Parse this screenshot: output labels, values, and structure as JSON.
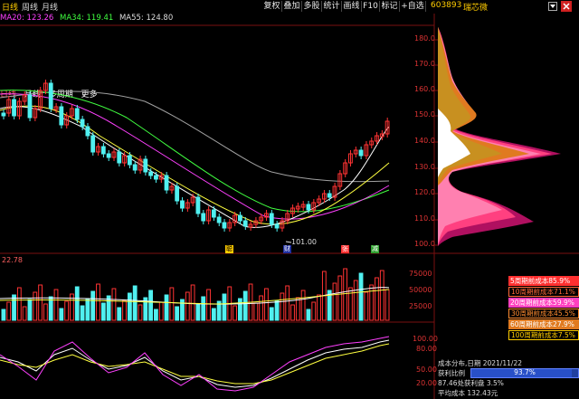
{
  "topbar": {
    "periods": [
      "日线",
      "周线",
      "月线"
    ],
    "tools": [
      "复权",
      "叠加",
      "多股",
      "统计",
      "画线",
      "F10",
      "标记",
      "+自选"
    ],
    "stock_code": "603893",
    "stock_name": "瑞芯微"
  },
  "ma_line": {
    "ma20": "MA20: 123.26",
    "ma34": "MA34: 119.41",
    "ma55": "MA55: 124.80"
  },
  "period_tabs": [
    "日线",
    "月线",
    "多周期",
    "更多"
  ],
  "price_axis": [
    "180.0",
    "170.0",
    "160.0",
    "150.0",
    "140.0",
    "130.0",
    "120.0",
    "110.0",
    "100.0"
  ],
  "low_label": "101.00",
  "markers": [
    "聪",
    "财",
    "张",
    "减"
  ],
  "volume": {
    "label": "22.78",
    "axis": [
      "75000",
      "50000",
      "25000"
    ]
  },
  "kdj_axis": [
    "100.00",
    "80.00",
    "50.00",
    "20.00"
  ],
  "cost_table": {
    "rows": [
      {
        "label": "5周期前成本85.9%",
        "color": "#ff3030"
      },
      {
        "label": "10周期前成本71.1%",
        "color": "#ff6a3a"
      },
      {
        "label": "20周期前成本59.9%",
        "color": "#ff40c0"
      },
      {
        "label": "30周期前成本45.5%",
        "color": "#ff8c30"
      },
      {
        "label": "60周期前成本27.9%",
        "color": "#e07a20"
      },
      {
        "label": "100周期前成本7.5%",
        "color": "#ffcc00"
      }
    ]
  },
  "cost_info": {
    "date_line": "成本分布,日期  2021/11/22",
    "profit_label": "获利比例",
    "profit_value": "93.7%",
    "profit_line": "87.46处获利盘  3.5%",
    "avg_cost": "平均成本  132.43元"
  },
  "colors": {
    "up": "#ff3333",
    "down": "#50f0f0",
    "accent": "#ffcc00"
  }
}
